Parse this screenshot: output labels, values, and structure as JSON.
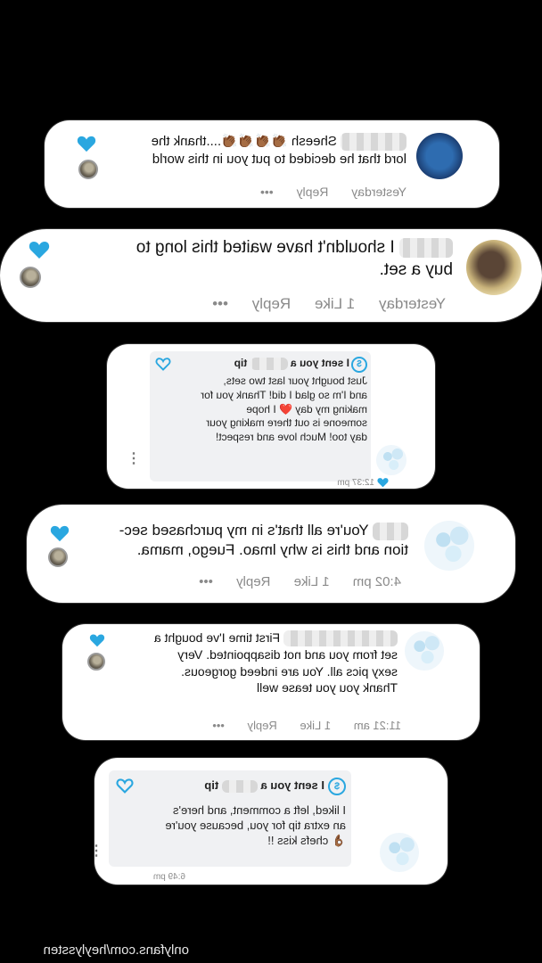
{
  "colors": {
    "background": "#000000",
    "card": "#ffffff",
    "accent": "#2aa7e0",
    "muted": "#8a8a8a"
  },
  "comments": [
    {
      "text_line1": "Sheesh 👏🏾👏🏾👏🏾👏🏾....thank the",
      "text_line2": "lord that he decided to put you in this world",
      "time": "Yesterday",
      "reply": "Reply",
      "more": "•••"
    },
    {
      "text_line1": "I shouldn't have waited this long to",
      "text_line2": "buy a set.",
      "time": "Yesterday",
      "likes": "1 Like",
      "reply": "Reply",
      "more": "•••"
    },
    {
      "text_line1": "You're all that's in my purchased sec-",
      "text_line2": "tion and this is why lmao. Fuego, mama.",
      "time": "4:02 pm",
      "likes": "1 Like",
      "reply": "Reply",
      "more": "•••"
    },
    {
      "text_line1": "First time I've bought a",
      "text_line2": "set from you and not disappointed. Very",
      "text_line3": "sexy pics all. You are indeed gorgeous.",
      "text_line4": "Thank you you tease well",
      "time": "11:21 am",
      "likes": "1 Like",
      "reply": "Reply",
      "more": "•••"
    }
  ],
  "tips": [
    {
      "head_prefix": "I sent you a",
      "head_suffix": "tip",
      "body_line1": "Just bought your last two sets,",
      "body_line2": "and I'm so glad I did! Thank you for",
      "body_line3": "making my day ❤️ I hope",
      "body_line4": "someone is out there making your",
      "body_line5": "day too! Much love and respect!",
      "time": "12:37 pm",
      "dollar": "$",
      "menu": "⋮"
    },
    {
      "head_prefix": "I sent you a",
      "head_suffix": "tip",
      "body_line1": "I liked, left a comment, and here's",
      "body_line2": "an extra tip for you, because you're",
      "body_line3": "👌🏾 chefs kiss !!",
      "time": "6:49 pm",
      "dollar": "$",
      "menu": "⋮"
    }
  ],
  "watermark": "onlyfans.com/heylyssten",
  "icons": {
    "heart": "heart-icon",
    "heart_tip": "heart-outline-icon",
    "dollar": "dollar-circle-icon",
    "menu": "more-vertical-icon"
  }
}
